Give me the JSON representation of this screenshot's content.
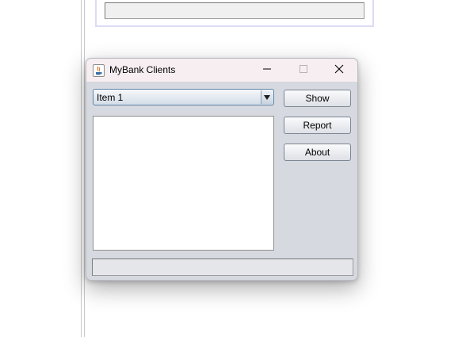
{
  "window": {
    "title": "MyBank Clients"
  },
  "titlebar": {
    "app_icon": "java-icon",
    "minimize_icon": "minimize-icon",
    "maximize_icon": "maximize-icon",
    "close_icon": "close-icon"
  },
  "combo": {
    "selected": "Item 1",
    "arrow_icon": "chevron-down-icon"
  },
  "list": {
    "items": []
  },
  "buttons": {
    "show": "Show",
    "report": "Report",
    "about": "About"
  },
  "status": {
    "text": ""
  },
  "colors": {
    "window_bg": "#d6d9df",
    "titlebar_bg": "#f7eef2",
    "combo_border": "#5d82a8"
  }
}
